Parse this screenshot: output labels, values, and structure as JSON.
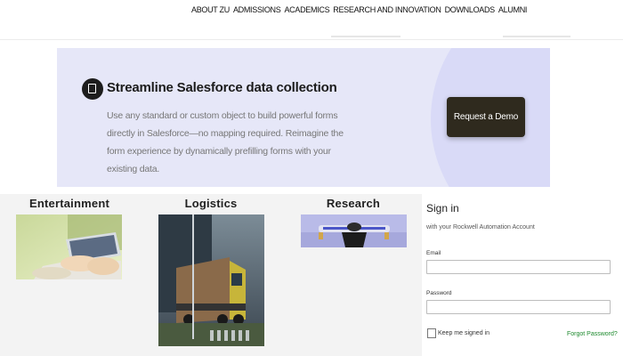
{
  "nav": {
    "items": [
      "ABOUT ZU",
      "ADMISSIONS",
      "ACADEMICS",
      "RESEARCH AND INNOVATION",
      "DOWNLOADS",
      "ALUMNI"
    ]
  },
  "promo": {
    "title": "Streamline Salesforce data collection",
    "description": "Use any standard or custom object to build powerful forms directly in Salesforce—no mapping required. Reimagine the form experience by dynamically prefilling forms with your existing data.",
    "cta_label": "Request a Demo",
    "logo_icon": "form-logo-icon",
    "colors": {
      "background": "#e6e7f8",
      "cta": "#2f2a1e"
    }
  },
  "industries": [
    {
      "title": "Entertainment",
      "image": "hands-on-laptop-photo"
    },
    {
      "title": "Logistics",
      "image": "truck-photo"
    },
    {
      "title": "Research",
      "image": "lab-equipment-photo"
    }
  ],
  "signin": {
    "title": "Sign in",
    "subtitle": "with your Rockwell Automation Account",
    "email_label": "Email",
    "email_value": "",
    "password_label": "Password",
    "password_value": "",
    "keep_signed_in_label": "Keep me signed in",
    "keep_signed_in": false,
    "forgot_label": "Forgot Password?",
    "forgot_color": "#1e8a2e"
  }
}
